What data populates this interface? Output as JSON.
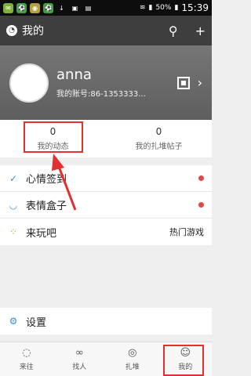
{
  "status_bar": {
    "time": "15:39",
    "battery": "50%"
  },
  "header": {
    "title": "我的"
  },
  "profile": {
    "name": "anna",
    "account": "我的账号:86-1353333..."
  },
  "stats": [
    {
      "count": "0",
      "label": "我的动态"
    },
    {
      "count": "0",
      "label": "我的扎堆帖子"
    }
  ],
  "menu": {
    "mood_sign": "心情签到",
    "emoji_box": "表情盒子",
    "play": "来玩吧",
    "play_right": "热门游戏",
    "settings": "设置"
  },
  "tabbar": [
    {
      "label": "来往",
      "icon": "chat-icon"
    },
    {
      "label": "找人",
      "icon": "glasses-icon"
    },
    {
      "label": "扎堆",
      "icon": "circle-icon"
    },
    {
      "label": "我的",
      "icon": "me-icon"
    }
  ],
  "colors": {
    "header_bg": "#3e3e3e",
    "profile_bg": "#6f6f6f",
    "dot": "#e64545",
    "highlight": "#e23030"
  }
}
